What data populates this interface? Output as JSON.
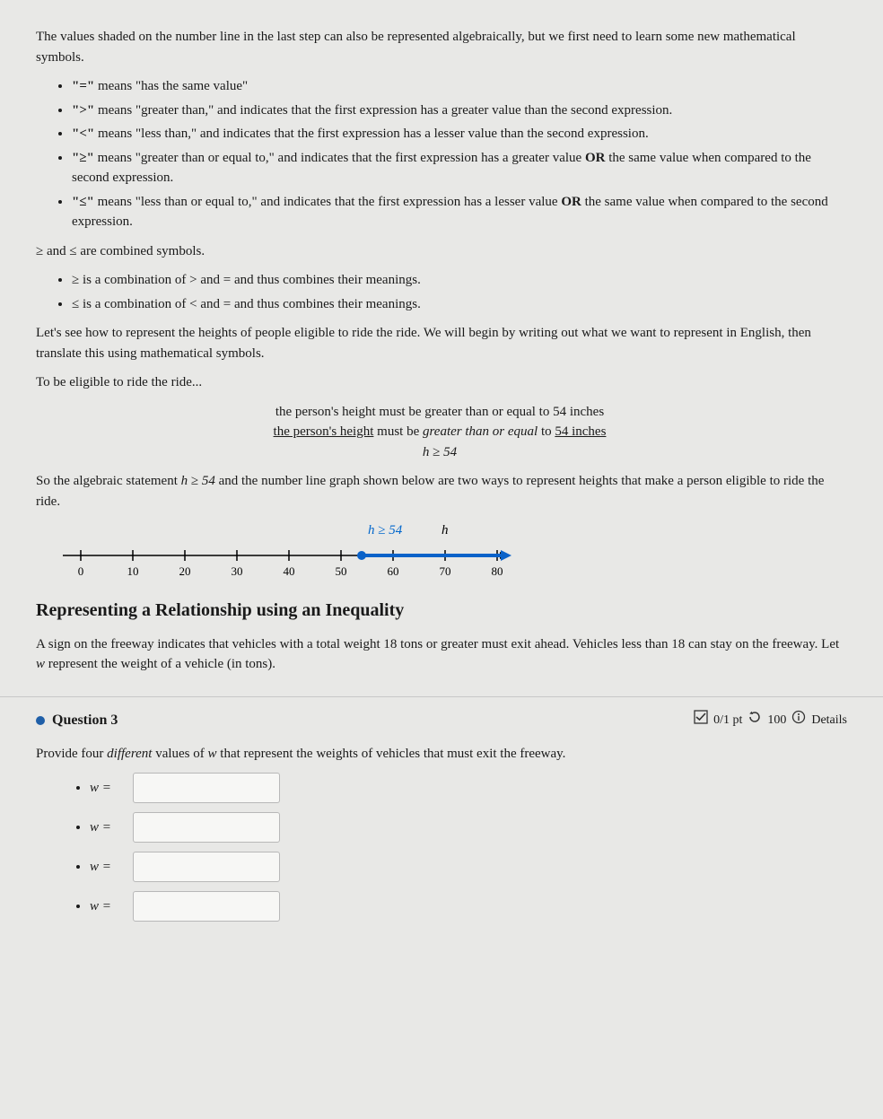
{
  "intro": "The values shaded on the number line in the last step can also be represented algebraically, but we first need to learn some new mathematical symbols.",
  "symbol_list": [
    {
      "sym": "\"=\"",
      "text": " means \"has the same value\""
    },
    {
      "sym": "\">\"",
      "text": " means \"greater than,\" and indicates that the first expression has a greater value than the second expression."
    },
    {
      "sym": "\"<\"",
      "text": " means \"less than,\" and indicates that the first expression has a lesser value than the second expression."
    },
    {
      "sym": "\"≥\"",
      "text_pre": " means \"greater than or equal to,\" and indicates that the first expression has a greater value ",
      "or_word": "OR",
      "text_post": " the same value when compared to the second expression."
    },
    {
      "sym": "\"≤\"",
      "text_pre": " means \"less than or equal to,\" and indicates that the first expression has a lesser value ",
      "or_word": "OR",
      "text_post": " the same value when compared to the second expression."
    }
  ],
  "combined_intro": "≥ and ≤ are combined symbols.",
  "combined_list": [
    "≥ is a combination of > and = and thus combines their meanings.",
    "≤ is a combination of < and = and thus combines their meanings."
  ],
  "lets_see": "Let's see how to represent the heights of people eligible to ride the ride. We will begin by writing out what we want to represent in English, then translate this using mathematical symbols.",
  "eligible_intro": "To be eligible to ride the ride...",
  "line1": "the person's height must be greater than or equal to 54 inches",
  "line2_u1": "the person's height",
  "line2_mid": " must be ",
  "line2_i": "greater than or equal",
  "line2_mid2": " to ",
  "line2_u2": "54 inches",
  "line3": "h ≥ 54",
  "so_the_pre": "So the algebraic statement ",
  "so_the_math": "h ≥ 54",
  "so_the_post": " and the number line graph shown below are two ways to represent heights that make a person eligible to ride the ride.",
  "numline_label": "h ≥ 54",
  "numline_var": "h",
  "chart_data": {
    "type": "numberline",
    "ticks": [
      0,
      10,
      20,
      30,
      40,
      50,
      60,
      70,
      80
    ],
    "closed_start": 54,
    "direction": "right",
    "arrow": true,
    "label": "h ≥ 54"
  },
  "section_title": "Representing a Relationship using an Inequality",
  "problem_text_pre": "A sign on the freeway indicates that vehicles with a total weight 18 tons or greater must exit ahead. Vehicles less than 18 can stay on the freeway. Let ",
  "problem_var": "w",
  "problem_text_post": " represent the weight of a vehicle (in tons).",
  "question_label": "Question 3",
  "score": "0/1 pt",
  "retries": "100",
  "details_label": "Details",
  "q3_prompt_pre": "Provide four ",
  "q3_prompt_em": "different",
  "q3_prompt_mid": " values of ",
  "q3_prompt_var": "w",
  "q3_prompt_post": " that represent the weights of vehicles that must exit the freeway.",
  "w_label": "w ="
}
